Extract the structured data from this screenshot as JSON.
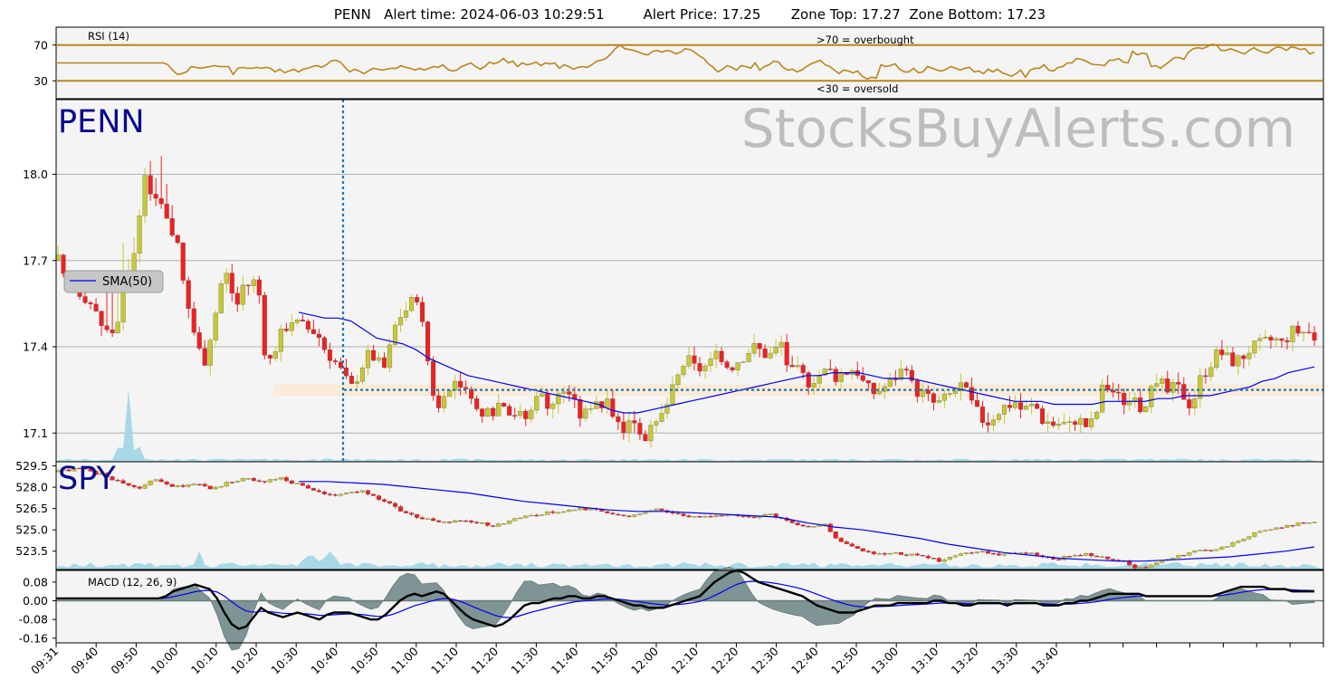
{
  "header": {
    "title": "PENN   Alert time: 2024-06-03 10:29:51         Alert Price: 17.25       Zone Top: 17.27  Zone Bottom: 17.23"
  },
  "watermark": "StocksBuyAlerts.com",
  "colors": {
    "up_candle": "#c8c832",
    "down_candle": "#f02020",
    "sma": "#0000ee",
    "volume": "#a8d8e6",
    "rsi": "#b8861b",
    "macd_line": "#000000",
    "signal_line": "#0000ee",
    "histogram": "#7f9494",
    "alert_line": "#1f77b4",
    "zone": "#fbe9d2",
    "panel_bg": "#f4f4f4",
    "grid": "#b0b0b0"
  },
  "chart_data": [
    {
      "type": "line",
      "panel": "rsi",
      "label": "RSI (14)",
      "yticks": [
        "70",
        "30"
      ],
      "ylim": [
        10,
        90
      ],
      "overbought": 70,
      "oversold": 30,
      "overbought_label": ">70 = overbought",
      "oversold_label": "<30 = oversold",
      "values": [
        50,
        50,
        50,
        50,
        50,
        50,
        50,
        50,
        50,
        50,
        50,
        50,
        50,
        50,
        50,
        50,
        50,
        50,
        50,
        50,
        50,
        50,
        50,
        50,
        48,
        42,
        37,
        38,
        40,
        46,
        45,
        44,
        45,
        46,
        47,
        46,
        46,
        46,
        37,
        44,
        45,
        44,
        44,
        45,
        44,
        45,
        44,
        40,
        43,
        39,
        41,
        43,
        40,
        43,
        44,
        46,
        47,
        45,
        48,
        52,
        53,
        51,
        45,
        40,
        43,
        41,
        38,
        41,
        44,
        43,
        42,
        43,
        44,
        44,
        47,
        45,
        44,
        42,
        44,
        42,
        44,
        46,
        45,
        48,
        43,
        41,
        42,
        46,
        48,
        50,
        46,
        43,
        46,
        51,
        49,
        51,
        55,
        50,
        52,
        46,
        50,
        48,
        49,
        51,
        47,
        50,
        49,
        50,
        44,
        48,
        46,
        43,
        45,
        46,
        45,
        48,
        52,
        53,
        55,
        60,
        66,
        70,
        66,
        65,
        64,
        62,
        60,
        59,
        63,
        64,
        62,
        64,
        63,
        60,
        62,
        66,
        65,
        62,
        58,
        55,
        49,
        45,
        40,
        43,
        47,
        45,
        42,
        47,
        46,
        44,
        50,
        42,
        46,
        48,
        52,
        51,
        45,
        42,
        43,
        40,
        42,
        46,
        49,
        51,
        53,
        48,
        46,
        42,
        38,
        42,
        41,
        39,
        41,
        35,
        32,
        34,
        33,
        48,
        46,
        47,
        49,
        43,
        40,
        40,
        44,
        39,
        40,
        46,
        44,
        42,
        41,
        43,
        46,
        44,
        42,
        44,
        45,
        40,
        41,
        38,
        43,
        40,
        43,
        39,
        37,
        35,
        38,
        42,
        34,
        42,
        44,
        44,
        48,
        42,
        41,
        45,
        46,
        50,
        50,
        55,
        54,
        52,
        49,
        48,
        48,
        47,
        53,
        53,
        55,
        51,
        50,
        63,
        59,
        61,
        60,
        46,
        47,
        44,
        48,
        52,
        56,
        56,
        54,
        62,
        66,
        67,
        66,
        68,
        71,
        70,
        64,
        64,
        66,
        64,
        62,
        60,
        64,
        67,
        64,
        62,
        61,
        65,
        68,
        67,
        64,
        68,
        67,
        65,
        66,
        60,
        62
      ]
    },
    {
      "type": "candlestick",
      "panel": "price",
      "symbol": "PENN",
      "yticks": [
        "18.0",
        "17.7",
        "17.4",
        "17.1"
      ],
      "ylim": [
        17.0,
        18.26
      ],
      "legend": "SMA(50)",
      "alert_price": 17.25,
      "zone_top": 17.27,
      "zone_bottom": 17.23,
      "alert_time": "10:29",
      "path": [
        17.7,
        17.62,
        17.65,
        17.6,
        17.58,
        17.55,
        17.5,
        17.46,
        17.44,
        17.5,
        17.6,
        17.65,
        17.8,
        18.0,
        17.94,
        17.9,
        17.85,
        17.8,
        17.75,
        17.6,
        17.5,
        17.4,
        17.35,
        17.45,
        17.55,
        17.68,
        17.6,
        17.55,
        17.63,
        17.61,
        17.65,
        17.4,
        17.35,
        17.42,
        17.46,
        17.5,
        17.48,
        17.47,
        17.46,
        17.45,
        17.4,
        17.37,
        17.34,
        17.3,
        17.25,
        17.3,
        17.35,
        17.38,
        17.35,
        17.32,
        17.4,
        17.5,
        17.52,
        17.55,
        17.58,
        17.45,
        17.3,
        17.18,
        17.2,
        17.25,
        17.3,
        17.26,
        17.2,
        17.18,
        17.15,
        17.17,
        17.2,
        17.22,
        17.18,
        17.17,
        17.15,
        17.16,
        17.25,
        17.22,
        17.2,
        17.22,
        17.25,
        17.24,
        17.18,
        17.15,
        17.2,
        17.22,
        17.19,
        17.2,
        17.14,
        17.12,
        17.14,
        17.15,
        17.08,
        17.1,
        17.12,
        17.17,
        17.22,
        17.28,
        17.34,
        17.35,
        17.32,
        17.33,
        17.34,
        17.36,
        17.35,
        17.33,
        17.35,
        17.37,
        17.39,
        17.4,
        17.38,
        17.37,
        17.39,
        17.42,
        17.3,
        17.32,
        17.3,
        17.28,
        17.3,
        17.31,
        17.32,
        17.3,
        17.31,
        17.32,
        17.33,
        17.28,
        17.25,
        17.24,
        17.26,
        17.27,
        17.3,
        17.32,
        17.28,
        17.25,
        17.24,
        17.22,
        17.2,
        17.21,
        17.23,
        17.25,
        17.27,
        17.22,
        17.18,
        17.15,
        17.14,
        17.17,
        17.19,
        17.2,
        17.21,
        17.18,
        17.19,
        17.2,
        17.15,
        17.14,
        17.13,
        17.14,
        17.12,
        17.15,
        17.14,
        17.12,
        17.15,
        17.25,
        17.26,
        17.24,
        17.21,
        17.22,
        17.2,
        17.19,
        17.23,
        17.25,
        17.27,
        17.24,
        17.26,
        17.25,
        17.2,
        17.23,
        17.3,
        17.33,
        17.37,
        17.38,
        17.36,
        17.35,
        17.36,
        17.39,
        17.4,
        17.41,
        17.42,
        17.43,
        17.41,
        17.44,
        17.46,
        17.45,
        17.46,
        17.42
      ],
      "sma": [
        17.52,
        17.51,
        17.5,
        17.5,
        17.49,
        17.46,
        17.43,
        17.42,
        17.41,
        17.39,
        17.36,
        17.34,
        17.32,
        17.3,
        17.29,
        17.28,
        17.27,
        17.26,
        17.25,
        17.24,
        17.23,
        17.22,
        17.21,
        17.2,
        17.18,
        17.17,
        17.17,
        17.18,
        17.19,
        17.2,
        17.21,
        17.22,
        17.23,
        17.24,
        17.25,
        17.26,
        17.27,
        17.28,
        17.29,
        17.3,
        17.3,
        17.31,
        17.31,
        17.31,
        17.3,
        17.29,
        17.29,
        17.29,
        17.28,
        17.27,
        17.26,
        17.25,
        17.24,
        17.23,
        17.22,
        17.21,
        17.21,
        17.21,
        17.2,
        17.2,
        17.2,
        17.2,
        17.21,
        17.21,
        17.21,
        17.21,
        17.22,
        17.22,
        17.23,
        17.23,
        17.23,
        17.24,
        17.25,
        17.26,
        17.28,
        17.29,
        17.31,
        17.32,
        17.33
      ]
    },
    {
      "type": "candlestick",
      "panel": "spy",
      "symbol": "SPY",
      "yticks": [
        "529.5",
        "528.0",
        "526.5",
        "525.0",
        "523.5"
      ],
      "ylim": [
        522.4,
        529.6
      ],
      "path": [
        529.1,
        529.2,
        529.3,
        529.2,
        529.0,
        528.9,
        528.6,
        528.4,
        528.1,
        527.9,
        528.3,
        528.5,
        528.2,
        528.0,
        528.1,
        528.3,
        528.2,
        527.9,
        528.0,
        528.3,
        528.5,
        528.6,
        528.5,
        528.4,
        528.5,
        528.6,
        528.4,
        528.2,
        528.0,
        527.8,
        527.5,
        527.4,
        527.5,
        527.6,
        527.8,
        527.5,
        527.2,
        526.9,
        526.5,
        526.2,
        526.0,
        525.8,
        525.6,
        525.5,
        525.6,
        525.7,
        525.6,
        525.5,
        525.4,
        525.3,
        525.5,
        525.7,
        525.9,
        526.0,
        526.1,
        526.2,
        526.2,
        526.3,
        526.4,
        526.5,
        526.4,
        526.3,
        526.2,
        526.1,
        526.0,
        526.1,
        526.3,
        526.5,
        526.4,
        526.2,
        526.0,
        525.9,
        525.9,
        526.0,
        526.0,
        526.1,
        526.1,
        525.9,
        525.9,
        526.0,
        526.1,
        525.8,
        525.6,
        525.4,
        525.2,
        525.2,
        525.4,
        524.5,
        524.1,
        523.9,
        523.6,
        523.4,
        523.3,
        523.3,
        523.4,
        523.3,
        523.3,
        523.2,
        523.0,
        522.8,
        523.1,
        523.3,
        523.4,
        523.5,
        523.4,
        523.3,
        523.2,
        523.3,
        523.4,
        523.4,
        523.2,
        523.0,
        522.9,
        523.1,
        523.2,
        523.3,
        523.2,
        523.1,
        523.0,
        522.9,
        522.7,
        522.3,
        522.4,
        522.6,
        522.8,
        523.0,
        523.2,
        523.4,
        523.5,
        523.5,
        523.6,
        523.8,
        524.1,
        524.4,
        524.7,
        524.9,
        525.1,
        525.2,
        525.3,
        525.4,
        525.5,
        525.5
      ],
      "sma": [
        528.4,
        528.4,
        528.3,
        528.2,
        528.0,
        527.8,
        527.6,
        527.3,
        527.0,
        526.8,
        526.6,
        526.4,
        526.3,
        526.3,
        526.2,
        526.1,
        526.0,
        525.9,
        525.5,
        525.2,
        525.0,
        524.7,
        524.4,
        524.0,
        523.7,
        523.4,
        523.2,
        523.0,
        522.9,
        522.8,
        522.8,
        522.9,
        523.0,
        523.1,
        523.3,
        523.5,
        523.8
      ]
    },
    {
      "type": "line",
      "panel": "macd",
      "label": "MACD (12, 26, 9)",
      "yticks": [
        "0.08",
        "0.00",
        "-0.08",
        "-0.16"
      ],
      "ylim": [
        -0.18,
        0.13
      ],
      "macd": [
        0.01,
        0.01,
        0.01,
        0.01,
        0.01,
        0.01,
        0.01,
        0.01,
        0.01,
        0.01,
        0.01,
        0.01,
        0.01,
        0.01,
        0.01,
        0.02,
        0.04,
        0.05,
        0.06,
        0.07,
        0.06,
        0.05,
        0.01,
        -0.05,
        -0.1,
        -0.12,
        -0.11,
        -0.07,
        -0.03,
        -0.05,
        -0.06,
        -0.07,
        -0.06,
        -0.05,
        -0.06,
        -0.07,
        -0.08,
        -0.06,
        -0.05,
        -0.05,
        -0.05,
        -0.06,
        -0.07,
        -0.08,
        -0.08,
        -0.06,
        -0.03,
        0.0,
        0.02,
        0.03,
        0.02,
        0.03,
        0.04,
        0.03,
        0.0,
        -0.03,
        -0.06,
        -0.08,
        -0.09,
        -0.1,
        -0.11,
        -0.1,
        -0.08,
        -0.05,
        -0.02,
        -0.01,
        -0.01,
        0.0,
        0.01,
        0.01,
        0.02,
        0.02,
        0.01,
        0.01,
        0.02,
        0.02,
        0.01,
        0.0,
        -0.01,
        -0.02,
        -0.02,
        -0.03,
        -0.03,
        -0.03,
        -0.02,
        -0.01,
        0.0,
        0.01,
        0.02,
        0.05,
        0.08,
        0.1,
        0.12,
        0.13,
        0.12,
        0.1,
        0.08,
        0.07,
        0.06,
        0.05,
        0.04,
        0.03,
        0.02,
        0.0,
        -0.02,
        -0.03,
        -0.04,
        -0.05,
        -0.05,
        -0.05,
        -0.04,
        -0.03,
        -0.02,
        -0.02,
        -0.02,
        -0.01,
        -0.01,
        -0.01,
        -0.01,
        -0.01,
        0.0,
        0.0,
        -0.01,
        -0.01,
        -0.02,
        -0.02,
        -0.01,
        -0.01,
        -0.01,
        -0.01,
        -0.02,
        -0.01,
        -0.01,
        -0.01,
        -0.01,
        -0.02,
        -0.02,
        -0.02,
        -0.01,
        -0.01,
        0.0,
        0.0,
        0.01,
        0.02,
        0.03,
        0.03,
        0.03,
        0.03,
        0.03,
        0.02,
        0.02,
        0.02,
        0.02,
        0.02,
        0.02,
        0.02,
        0.02,
        0.02,
        0.02,
        0.03,
        0.04,
        0.05,
        0.06,
        0.06,
        0.06,
        0.06,
        0.05,
        0.05,
        0.05,
        0.04,
        0.04,
        0.04,
        0.04
      ]
    }
  ],
  "xaxis": {
    "labels": [
      "09:31",
      "09:40",
      "09:50",
      "10:00",
      "10:10",
      "10:20",
      "10:30",
      "10:40",
      "10:50",
      "11:00",
      "11:10",
      "11:20",
      "11:30",
      "11:40",
      "11:50",
      "12:00",
      "12:10",
      "12:20",
      "12:30",
      "12:40",
      "12:50",
      "13:00",
      "13:10",
      "13:20",
      "13:30",
      "13:40"
    ],
    "minor_ticks": 8
  }
}
